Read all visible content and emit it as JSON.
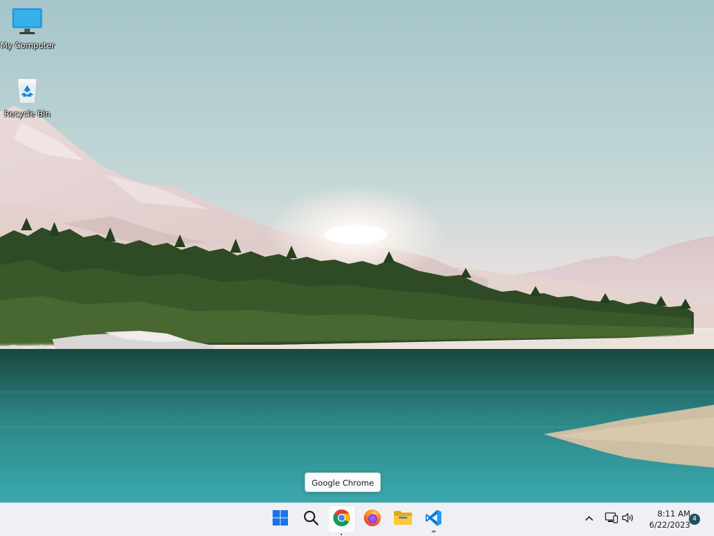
{
  "desktop": {
    "icons": [
      {
        "label": "My Computer",
        "icon": "monitor-icon"
      },
      {
        "label": "Recycle Bin",
        "icon": "recycle-bin-icon"
      }
    ]
  },
  "tooltip": {
    "text": "Google Chrome"
  },
  "taskbar": {
    "apps": [
      {
        "name": "Start",
        "icon": "windows-start-icon"
      },
      {
        "name": "Search",
        "icon": "search-icon"
      },
      {
        "name": "Google Chrome",
        "icon": "chrome-icon"
      },
      {
        "name": "Firefox",
        "icon": "firefox-icon"
      },
      {
        "name": "File Explorer",
        "icon": "file-explorer-icon"
      },
      {
        "name": "Visual Studio Code",
        "icon": "vscode-icon",
        "running": true
      }
    ],
    "tray": {
      "icons": [
        "chevron-up-icon",
        "network-icon",
        "volume-icon"
      ],
      "time": "8:11 AM",
      "date": "6/22/2023",
      "notification_count": "4"
    }
  },
  "colors": {
    "sky_top": "#a9c7cc",
    "sky_horizon": "#eadfe0",
    "water": "#2f8e92",
    "forest": "#2c4a22",
    "taskbar": "#eef0f3",
    "start_blue": "#1a73e8",
    "notification_badge": "#1f4e63"
  }
}
